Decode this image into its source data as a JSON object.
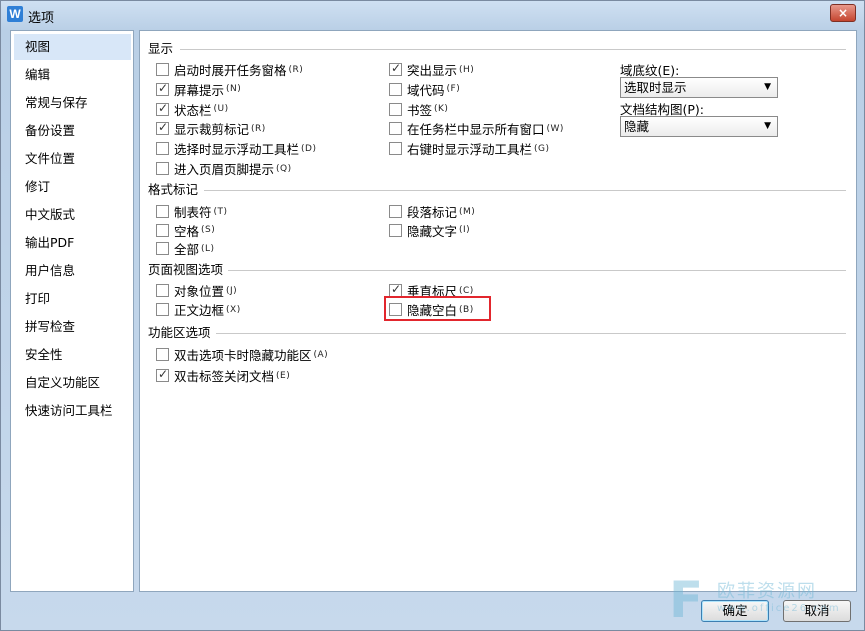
{
  "window": {
    "title": "选项",
    "app_icon_letter": "W",
    "close_label": "×"
  },
  "nav": {
    "items": [
      {
        "label": "视图",
        "active": true
      },
      {
        "label": "编辑"
      },
      {
        "label": "常规与保存"
      },
      {
        "label": "备份设置"
      },
      {
        "label": "文件位置"
      },
      {
        "label": "修订"
      },
      {
        "label": "中文版式"
      },
      {
        "label": "输出PDF"
      },
      {
        "label": "用户信息"
      },
      {
        "label": "打印"
      },
      {
        "label": "拼写检查"
      },
      {
        "label": "安全性"
      },
      {
        "label": "自定义功能区"
      },
      {
        "label": "快速访问工具栏"
      }
    ]
  },
  "display": {
    "title": "显示",
    "col1": [
      {
        "label": "启动时展开任务窗格",
        "hotkey": "(R)",
        "checked": false
      },
      {
        "label": "屏幕提示",
        "hotkey": "(N)",
        "checked": true
      },
      {
        "label": "状态栏",
        "hotkey": "(U)",
        "checked": true
      },
      {
        "label": "显示裁剪标记",
        "hotkey": "(R)",
        "checked": true
      },
      {
        "label": "选择时显示浮动工具栏",
        "hotkey": "(D)",
        "checked": false
      },
      {
        "label": "进入页眉页脚提示",
        "hotkey": "(Q)",
        "checked": false
      }
    ],
    "col2": [
      {
        "label": "突出显示",
        "hotkey": "(H)",
        "checked": true
      },
      {
        "label": "域代码",
        "hotkey": "(F)",
        "checked": false
      },
      {
        "label": "书签",
        "hotkey": "(K)",
        "checked": false
      },
      {
        "label": "在任务栏中显示所有窗口",
        "hotkey": "(W)",
        "checked": false
      },
      {
        "label": "右键时显示浮动工具栏",
        "hotkey": "(G)",
        "checked": false
      }
    ],
    "field_shading_label": "域底纹(E):",
    "field_shading_value": "选取时显示",
    "doc_map_label": "文档结构图(P):",
    "doc_map_value": "隐藏"
  },
  "format_marks": {
    "title": "格式标记",
    "col1": [
      {
        "label": "制表符",
        "hotkey": "(T)",
        "checked": false
      },
      {
        "label": "空格",
        "hotkey": "(S)",
        "checked": false
      },
      {
        "label": "全部",
        "hotkey": "(L)",
        "checked": false
      }
    ],
    "col2": [
      {
        "label": "段落标记",
        "hotkey": "(M)",
        "checked": false
      },
      {
        "label": "隐藏文字",
        "hotkey": "(I)",
        "checked": false
      }
    ]
  },
  "page_view": {
    "title": "页面视图选项",
    "col1": [
      {
        "label": "对象位置",
        "hotkey": "(J)",
        "checked": false
      },
      {
        "label": "正文边框",
        "hotkey": "(X)",
        "checked": false
      }
    ],
    "col2": [
      {
        "label": "垂直标尺",
        "hotkey": "(C)",
        "checked": true
      },
      {
        "label": "隐藏空白",
        "hotkey": "(B)",
        "checked": false
      }
    ]
  },
  "ribbon": {
    "title": "功能区选项",
    "col1": [
      {
        "label": "双击选项卡时隐藏功能区",
        "hotkey": "(A)",
        "checked": false
      },
      {
        "label": "双击标签关闭文档",
        "hotkey": "(E)",
        "checked": true
      }
    ]
  },
  "buttons": {
    "ok": "确定",
    "cancel": "取消"
  },
  "watermark": {
    "logo_letter": "F",
    "text": "欧菲资源网",
    "url": "www.office26.com"
  }
}
